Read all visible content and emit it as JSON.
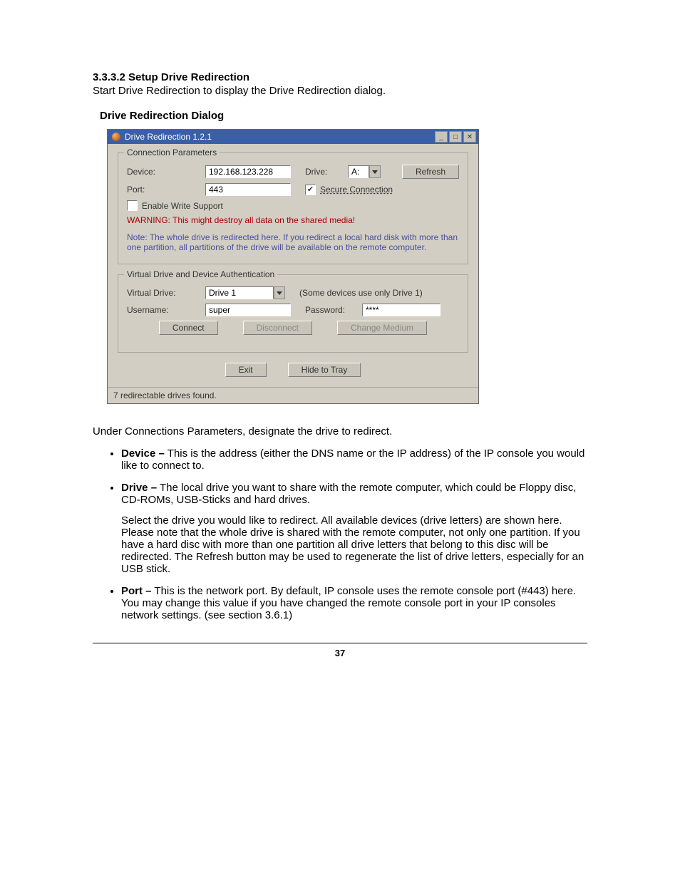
{
  "heading": "3.3.3.2 Setup Drive Redirection",
  "intro_line": "Start Drive Redirection to display the Drive Redirection dialog.",
  "dialog_caption": "Drive Redirection Dialog",
  "win": {
    "title": "Drive Redirection 1.2.1",
    "groups": {
      "conn": {
        "title": "Connection Parameters",
        "device_label": "Device:",
        "device_value": "192.168.123.228",
        "drive_label": "Drive:",
        "drive_value": "A:",
        "refresh": "Refresh",
        "port_label": "Port:",
        "port_value": "443",
        "secure_label": "Secure Connection",
        "enable_write": "Enable Write Support",
        "warning": "WARNING: This might destroy all data on the shared media!",
        "note": "Note: The whole drive is redirected here. If you redirect a local hard disk with more than one partition, all partitions of the drive will be available on the remote computer."
      },
      "auth": {
        "title": "Virtual Drive and Device Authentication",
        "vd_label": "Virtual Drive:",
        "vd_value": "Drive 1",
        "vd_hint": "(Some devices use only Drive 1)",
        "user_label": "Username:",
        "user_value": "super",
        "pass_label": "Password:",
        "pass_value": "****"
      }
    },
    "buttons": {
      "connect": "Connect",
      "disconnect": "Disconnect",
      "change_medium": "Change Medium",
      "exit": "Exit",
      "hide": "Hide to Tray"
    },
    "status": "7 redirectable drives found."
  },
  "body_para": "Under Connections Parameters, designate the drive to redirect.",
  "list": {
    "device": {
      "term": "Device –",
      "text": " This is the address (either the DNS name or the IP address) of the IP console you would like to connect to."
    },
    "drive": {
      "term": "Drive –",
      "text1": " The local drive you want to share with the remote computer, which could be Floppy disc, CD-ROMs, USB-Sticks and hard drives.",
      "text2": "Select the drive you would like to redirect. All available devices (drive letters) are shown here. Please note that the whole drive is shared with the remote computer, not only one partition. If you have a hard disc with more than one partition all drive letters that belong to this disc will be redirected. The Refresh button may be used to regenerate the list of drive letters, especially for an USB stick."
    },
    "port": {
      "term": "Port –",
      "text": " This is the network port. By default, IP console uses the remote console port (#443) here. You may change this value if you have changed the remote console port in your IP consoles network settings. (see section 3.6.1)"
    }
  },
  "page_number": "37"
}
